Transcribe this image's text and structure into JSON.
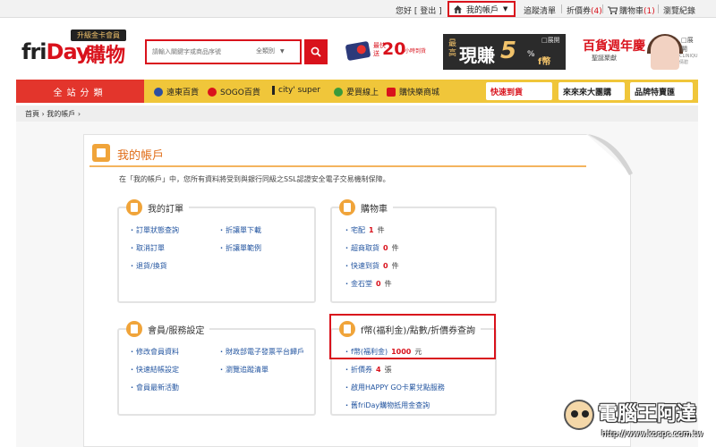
{
  "topbar": {
    "greeting": "您好",
    "logout": "[ 登出 ]",
    "account": "我的帳戶",
    "tracking": "追蹤清單",
    "coupons": "折價券",
    "coupons_count": "(4)",
    "cart": "購物車",
    "cart_count": "(1)",
    "history": "瀏覽紀錄"
  },
  "header": {
    "logo_badge": "升級金卡會員",
    "logo_fri": "fri",
    "logo_day": "Day",
    "logo_shop": "購物",
    "search_placeholder": "請輸入關鍵字或商品序號",
    "search_category": "全類別",
    "promo_small_1": "最快",
    "promo_small_2": "送",
    "promo_big": "20",
    "promo_tail": "小時到貨",
    "ad1_a": "最高",
    "ad1_b": "現賺",
    "ad1_c": "5",
    "ad1_d": "%",
    "ad1_e": "f幣",
    "ad1_close": "□展開",
    "ad2_title": "百貨週年慶",
    "ad2_sub": "聖誕聚獻",
    "ad2_close": "□展開",
    "ad2_brand": "CLINIQUE 倩碧"
  },
  "nav": {
    "all": "全站分類",
    "malls": [
      "遠東百貨",
      "SOGO百貨",
      "city' super",
      "愛買線上",
      "購快樂商城"
    ],
    "pills": [
      "快速到貨",
      "來來來大團購",
      "品牌特賣匯"
    ]
  },
  "breadcrumb": "首頁 › 我的帳戶 ›",
  "page": {
    "title": "我的帳戶",
    "intro": "在「我的帳戶」中，您所有資料將受到與銀行同級之SSL認證安全電子交易機制保障。"
  },
  "orders": {
    "title": "我的訂單",
    "left": [
      "訂單狀態查詢",
      "取消訂單",
      "退貨/換貨"
    ],
    "right": [
      "折讓單下載",
      "折讓單範例"
    ]
  },
  "cart_box": {
    "title": "購物車",
    "items": [
      {
        "label": "宅配",
        "count": "1",
        "unit": "件"
      },
      {
        "label": "超商取貨",
        "count": "0",
        "unit": "件"
      },
      {
        "label": "快速到貨",
        "count": "0",
        "unit": "件"
      },
      {
        "label": "金石堂",
        "count": "0",
        "unit": "件"
      }
    ]
  },
  "member": {
    "title": "會員/服務設定",
    "left": [
      "修改會員資料",
      "快速結帳設定",
      "會員最新活動"
    ],
    "right": [
      "財政部電子發票平台歸戶",
      "瀏覽追蹤清單"
    ]
  },
  "points": {
    "title": "f幣(福利金)/點數/折價券查詢",
    "coin_label": "f幣(福利金)",
    "coin_value": "1000",
    "coin_unit": "元",
    "coupon_label": "折價券",
    "coupon_value": "4",
    "coupon_unit": "張",
    "happygo": "啟用HAPPY GO卡累兌點服務",
    "old": "舊friDay購物抵用金查詢"
  },
  "watermark": {
    "text": "電腦王阿達",
    "url": "http://www.kocpc.com.tw"
  },
  "colors": {
    "brand_red": "#d9121c",
    "nav_yellow": "#f0c63a",
    "accent_orange": "#f0a43a",
    "link_blue": "#2355a0"
  }
}
